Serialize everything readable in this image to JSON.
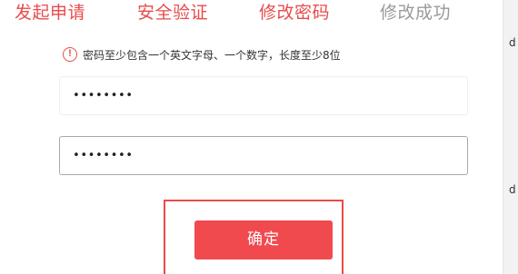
{
  "steps": [
    {
      "label": "发起申请",
      "state": "active"
    },
    {
      "label": "安全验证",
      "state": "active"
    },
    {
      "label": "修改密码",
      "state": "active"
    },
    {
      "label": "修改成功",
      "state": "inactive"
    }
  ],
  "hint": {
    "icon": "exclamation-circle-icon",
    "text": "密码至少包含一个英文字母、一个数字，长度至少8位"
  },
  "password_field": {
    "value": "••••••••"
  },
  "confirm_password_field": {
    "value": "••••••••"
  },
  "confirm_button": {
    "label": "确定"
  },
  "edge": {
    "glyph_1": "d",
    "glyph_2": "d"
  },
  "colors": {
    "accent": "#e84b4b",
    "button": "#f04a4f",
    "inactive_step": "#9a9a9a"
  }
}
